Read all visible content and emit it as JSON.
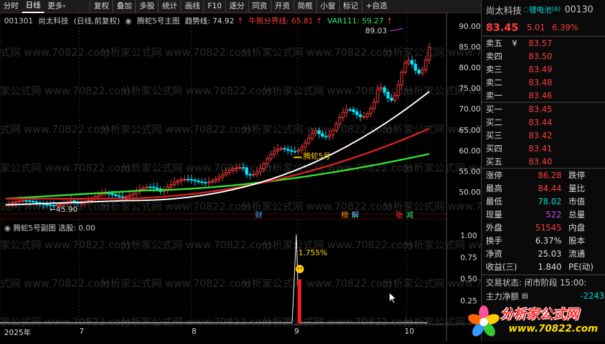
{
  "toolbar": {
    "items": [
      "分时",
      "日线",
      "更多",
      "复权",
      "叠加",
      "多股",
      "统计",
      "画线",
      "F10",
      "逐分",
      "同资",
      "开资",
      "简框",
      "小窗",
      "标记",
      "+自选"
    ],
    "more_arrow": "›"
  },
  "main_legend": {
    "code": "001301",
    "name": "尚太科技",
    "period": "(日线,前复权)",
    "indicator": "腾蛇5号主图",
    "trend_label": "趋势线: 74.92",
    "bull_bear_label": "牛熊分界线: 65.81",
    "var_label": "VAR111: 59.27"
  },
  "sub_legend": {
    "indicator": "腾蛇5号副图",
    "select_label": "选股: 0.00"
  },
  "price_axis": [
    "90.00",
    "85.00",
    "80.00",
    "75.00",
    "70.00",
    "65.00",
    "60.00",
    "55.00",
    "50.00"
  ],
  "sub_axis": [
    "1.00",
    "0.75",
    "0.50",
    "0.25"
  ],
  "time_axis": [
    "2025年",
    "7",
    "8",
    "9",
    "10"
  ],
  "annotations": {
    "high": "89.03",
    "low": "45.90",
    "tengshe": "腾蛇5号",
    "sub_pct": "1.755%",
    "markers": [
      "财",
      "榜",
      "解",
      "张",
      "减"
    ]
  },
  "side": {
    "name": "尚太科技",
    "sector": "锂电池",
    "sector_count": "(6)",
    "code": "00130",
    "price": "83.45",
    "change": "5.01",
    "change_pct": "6.39%",
    "asks": [
      {
        "label": "卖五",
        "mark": "¥",
        "price": "83.57"
      },
      {
        "label": "卖四",
        "mark": "",
        "price": "83.50"
      },
      {
        "label": "卖三",
        "mark": "",
        "price": "83.49"
      },
      {
        "label": "卖二",
        "mark": "",
        "price": "83.48"
      },
      {
        "label": "卖一",
        "mark": "",
        "price": "83.46"
      }
    ],
    "bids": [
      {
        "label": "买一",
        "price": "83.45"
      },
      {
        "label": "买二",
        "price": "83.44"
      },
      {
        "label": "买三",
        "price": "83.42"
      },
      {
        "label": "买四",
        "price": "83.41"
      },
      {
        "label": "买五",
        "price": "83.40"
      }
    ],
    "stats": [
      {
        "l1": "涨停",
        "v1": "86.28",
        "l2": "跌停"
      },
      {
        "l1": "最高",
        "v1": "84.44",
        "l2": "量比"
      },
      {
        "l1": "最低",
        "v1": "78.02",
        "l2": "市值"
      },
      {
        "l1": "现量",
        "v1": "522",
        "l2": "总量"
      },
      {
        "l1": "外盘",
        "v1": "51545",
        "l2": "内盘"
      },
      {
        "l1": "换手",
        "v1": "6.37%",
        "l2": "股本"
      },
      {
        "l1": "净资",
        "v1": "25.03",
        "l2": "流通"
      },
      {
        "l1": "收益(三)",
        "v1": "1.840",
        "l2": "PE(动)"
      }
    ],
    "trade_status": "交易状态: 闭市阶段 15:00:",
    "main_flow_label": "主力净额",
    "main_flow_value": "-2243"
  },
  "logo": {
    "text": "分析家公式网",
    "url": "www.70822.com"
  },
  "colors": {
    "up": "#ff3b3b",
    "down": "#00e5ff",
    "trend": "#ffffff",
    "bull_bear": "#e02020",
    "var111": "#2ee82e"
  }
}
